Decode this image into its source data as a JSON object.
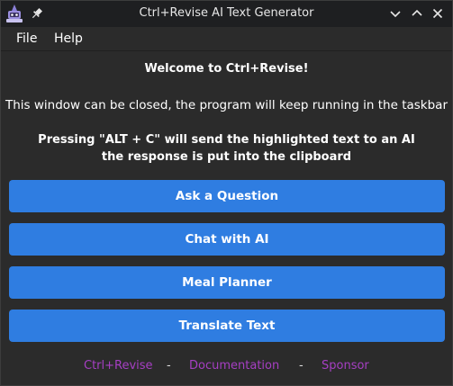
{
  "window": {
    "title": "Ctrl+Revise AI Text Generator"
  },
  "menu": {
    "items": [
      "File",
      "Help"
    ]
  },
  "content": {
    "welcome": "Welcome to Ctrl+Revise!",
    "info": "This window can be closed, the program will keep running in the taskbar",
    "hotkey_line1": "Pressing \"ALT + C\" will send the highlighted text to an AI",
    "hotkey_line2": "the response is put into the clipboard"
  },
  "buttons": [
    "Ask a Question",
    "Chat with AI",
    "Meal Planner",
    "Translate Text"
  ],
  "footer": {
    "links": [
      "Ctrl+Revise",
      "Documentation",
      "Sponsor"
    ],
    "separator": "-"
  },
  "colors": {
    "background": "#2b2b2b",
    "titlebar": "#1e1f21",
    "button": "#2f7de1",
    "link": "#a63fc3"
  },
  "icons": {
    "app": "robot-icon",
    "pin": "pin-icon",
    "minimize": "chevron-down-icon",
    "maximize": "chevron-up-icon",
    "close": "close-icon"
  }
}
